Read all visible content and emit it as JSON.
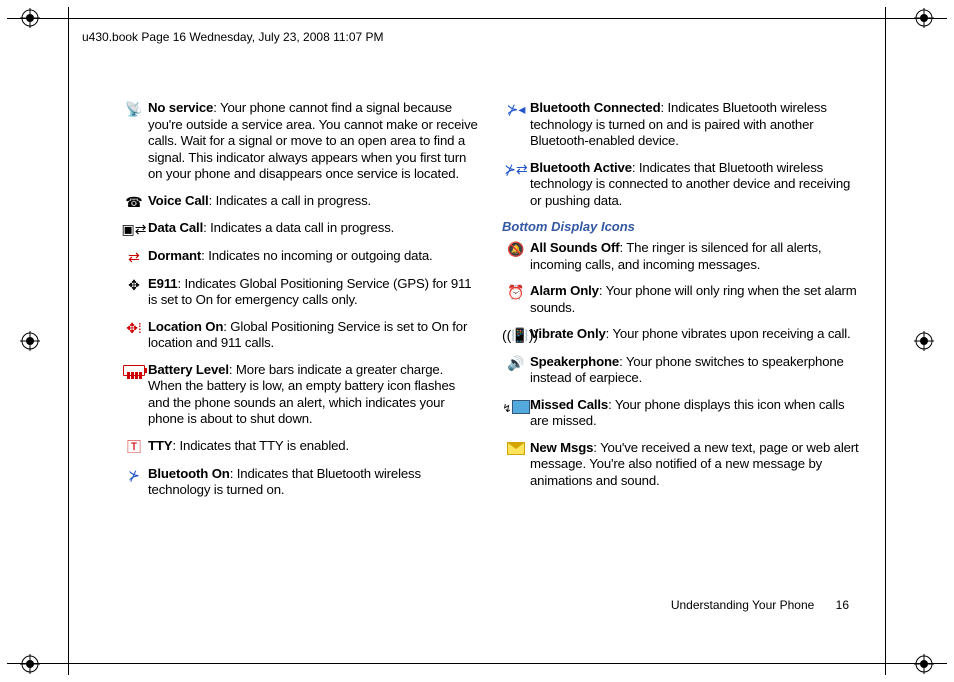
{
  "header": "u430.book  Page 16  Wednesday, July 23, 2008  11:07 PM",
  "left": [
    {
      "icon": "📡",
      "cls": "ico-blue",
      "strong": "No service",
      "text": ": Your phone cannot find a signal because you're outside a service area. You cannot make or receive calls. Wait for a signal or move to an open area to find a signal. This indicator always appears when you first turn on your phone and disappears once service is located."
    },
    {
      "icon": "☎",
      "cls": "",
      "strong": "Voice Call",
      "text": ": Indicates a call in progress."
    },
    {
      "icon": "▣⇄",
      "cls": "",
      "strong": "Data Call",
      "text": ": Indicates a data call in progress."
    },
    {
      "icon": "⇄",
      "cls": "ico-red",
      "strong": "Dormant",
      "text": ": Indicates no incoming or outgoing data."
    },
    {
      "icon": "✥",
      "cls": "",
      "strong": "E911",
      "text": ": Indicates Global Positioning Service (GPS) for 911 is set to On for emergency calls only."
    },
    {
      "icon": "✥⁞",
      "cls": "ico-red",
      "strong": "Location On",
      "text": ": Global Positioning Service is set to On for location and 911 calls."
    },
    {
      "icon": "__batt__",
      "cls": "",
      "strong": "Battery Level",
      "text": ": More bars indicate a greater charge. When the battery is low, an empty battery icon flashes and the phone sounds an alert, which indicates your phone is about to shut down."
    },
    {
      "icon": "🅃",
      "cls": "ico-red",
      "strong": "TTY",
      "text": ": Indicates that TTY is enabled."
    },
    {
      "icon": "⊁",
      "cls": "ico-blue",
      "strong": "Bluetooth On",
      "text": ": Indicates that Bluetooth wireless technology is turned on."
    }
  ],
  "rightTop": [
    {
      "icon": "⊁◂",
      "cls": "ico-blue",
      "strong": "Bluetooth Connected",
      "text": ": Indicates Bluetooth wireless technology is turned on and is paired with another Bluetooth-enabled device."
    },
    {
      "icon": "⊁⇄",
      "cls": "ico-blue",
      "strong": "Bluetooth Active",
      "text": ": Indicates that Bluetooth wireless technology is connected to another device and receiving or pushing data."
    }
  ],
  "subhead": "Bottom Display Icons",
  "rightBottom": [
    {
      "icon": "🔕",
      "cls": "ico-red",
      "strong": "All Sounds Off",
      "text": ": The ringer is silenced for all alerts, incoming calls, and incoming messages."
    },
    {
      "icon": "⏰",
      "cls": "",
      "strong": "Alarm Only",
      "text": ": Your phone will only ring when the set alarm sounds."
    },
    {
      "icon": "((📳))",
      "cls": "",
      "strong": "Vibrate Only",
      "text": ": Your phone vibrates upon receiving a call."
    },
    {
      "icon": "🔊",
      "cls": "",
      "strong": "Speakerphone",
      "text": ": Your phone switches to speakerphone instead of earpiece."
    },
    {
      "icon": "__missed__",
      "cls": "",
      "strong": "Missed Calls",
      "text": ": Your phone displays this icon when calls are missed."
    },
    {
      "icon": "__env__",
      "cls": "",
      "strong": "New Msgs",
      "text": ": You've received a new text, page or web alert message. You're also notified of a new message by animations and sound."
    }
  ],
  "footerSection": "Understanding Your Phone",
  "footerPage": "16"
}
